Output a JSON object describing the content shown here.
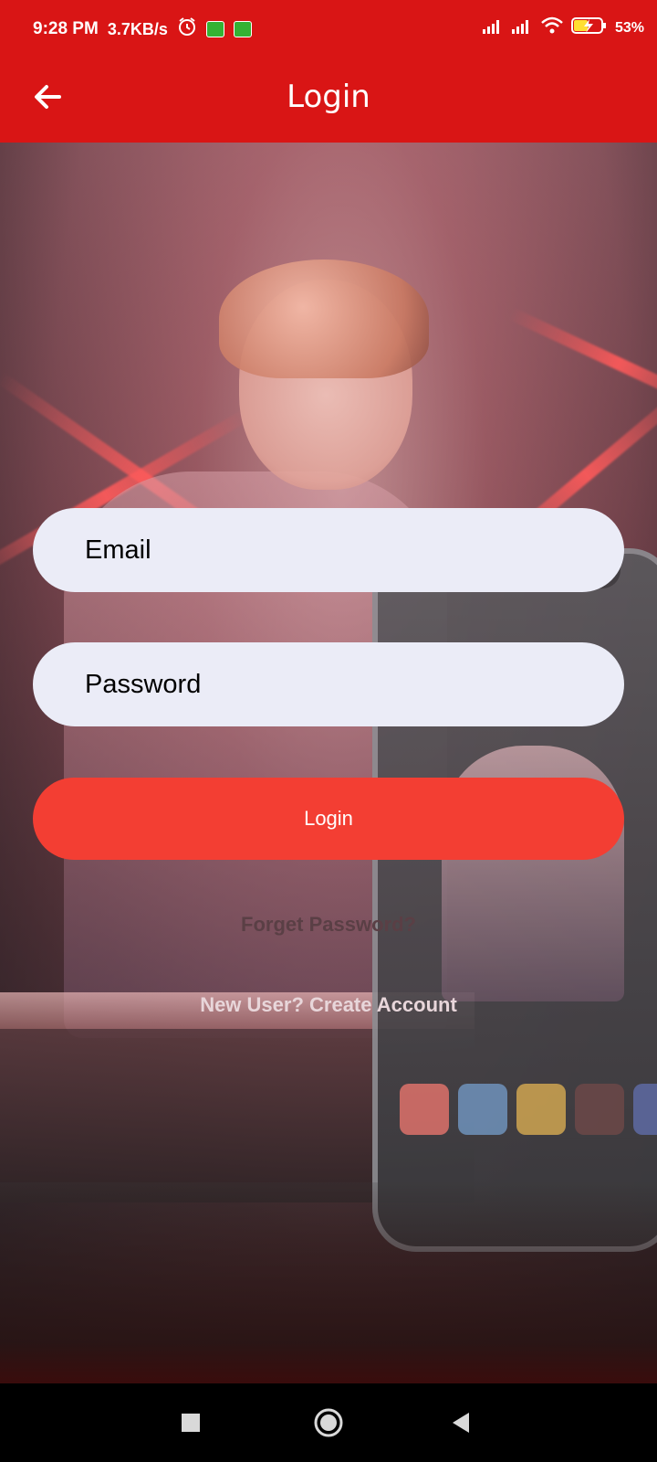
{
  "status_bar": {
    "time": "9:28 PM",
    "speed": "3.7KB/s",
    "battery": "53%"
  },
  "app_bar": {
    "title": "Login"
  },
  "form": {
    "email_placeholder": "Email",
    "password_placeholder": "Password",
    "login_button": "Login",
    "forgot_link": "Forget Password?",
    "create_account_link": "New User? Create Account"
  },
  "colors": {
    "app_bar": "#d91515",
    "login_button": "#f33e33",
    "field_background": "#ebecf7"
  }
}
